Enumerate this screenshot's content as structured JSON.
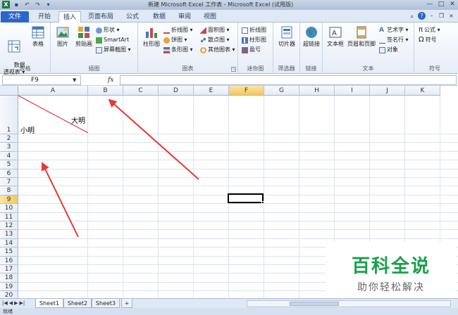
{
  "window": {
    "title": "新建 Microsoft Excel 工作表 - Microsoft Excel (试用版)",
    "controls": [
      "—",
      "□",
      "✕"
    ]
  },
  "tabs": [
    {
      "label": "文件"
    },
    {
      "label": "开始"
    },
    {
      "label": "插入"
    },
    {
      "label": "页面布局"
    },
    {
      "label": "公式"
    },
    {
      "label": "数据"
    },
    {
      "label": "审阅"
    },
    {
      "label": "视图"
    }
  ],
  "ribbon": {
    "tables": {
      "label": "表格",
      "pivot": "数据\n透视表 ▾",
      "table": "表格"
    },
    "illustrations": {
      "label": "插图",
      "picture": "图片",
      "clipart": "剪贴画",
      "shapes": "形状 ▾",
      "smartart": "SmartArt",
      "screenshot": "屏幕截图 ▾"
    },
    "charts": {
      "label": "图表",
      "column": "柱形图",
      "line": "折线图 ▾",
      "pie": "饼图 ▾",
      "bar": "条形图 ▾",
      "area": "面积图 ▾",
      "scatter": "散点图 ▾",
      "other": "其他图表 ▾"
    },
    "sparklines": {
      "label": "迷你图",
      "line": "折线图",
      "column": "柱形图",
      "winloss": "盈亏"
    },
    "filter": {
      "label": "筛选器",
      "slicer": "切片器"
    },
    "links": {
      "label": "链接",
      "hyperlink": "超链接"
    },
    "text": {
      "label": "文本",
      "textbox": "文本框",
      "headerfooter": "页眉和页脚",
      "wordart": "艺术字 ▾",
      "signature": "签名行 ▾",
      "object": "对象"
    },
    "symbols": {
      "label": "符号",
      "equation": "公式 ▾",
      "symbol": "符号"
    }
  },
  "formula_bar": {
    "name_box": "F9",
    "fx": "fx",
    "value": ""
  },
  "grid": {
    "columns": [
      "A",
      "B",
      "C",
      "D",
      "E",
      "F",
      "G",
      "H",
      "I",
      "J",
      "K"
    ],
    "rows": [
      "1",
      "2",
      "3",
      "4",
      "5",
      "6",
      "7",
      "8",
      "9",
      "10",
      "11",
      "12",
      "13",
      "14",
      "15",
      "16",
      "17",
      "18",
      "19",
      "20"
    ],
    "selected_column": "F",
    "selected_row": "9",
    "a1_bottom_left": "小明",
    "a1_top_right": "大明"
  },
  "watermark": {
    "title": "百科全说",
    "subtitle": "助你轻松解决"
  },
  "sheets": [
    "Sheet1",
    "Sheet2",
    "Sheet3"
  ],
  "status": "就绪",
  "colors": {
    "excel_green": "#1f7a3d",
    "file_tab": "#2a66c9",
    "arrow": "#e53935",
    "selection": "#f5c75c"
  }
}
